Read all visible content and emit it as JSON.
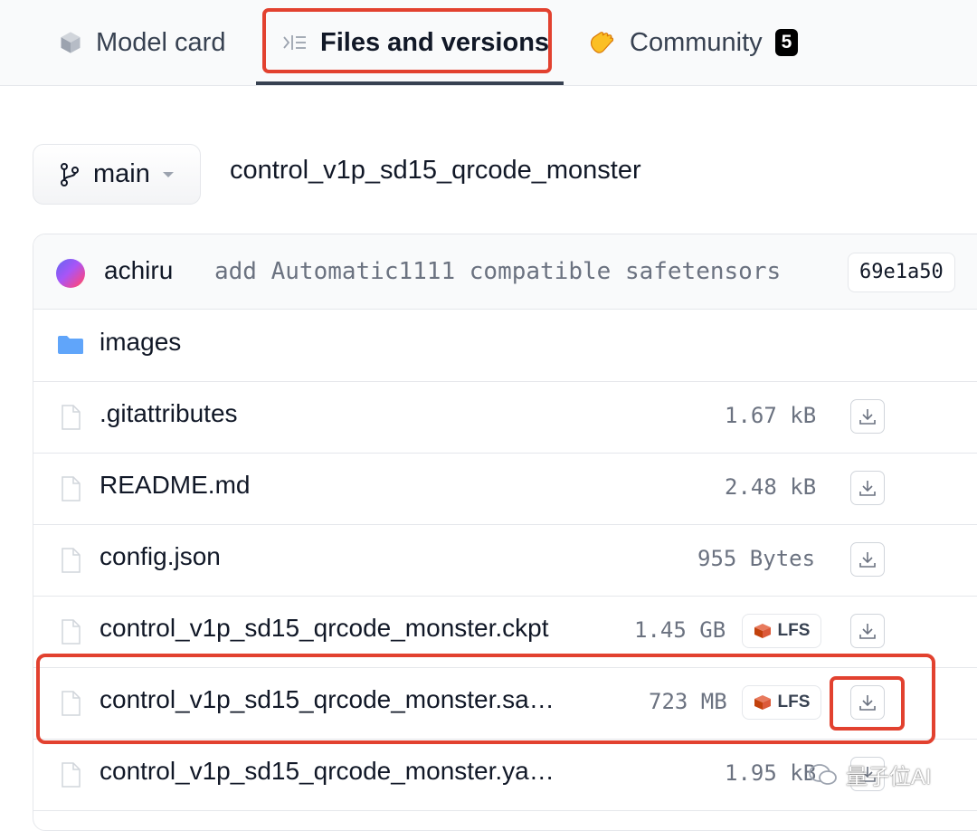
{
  "tabs": [
    {
      "label": "Model card",
      "icon": "cube-icon"
    },
    {
      "label": "Files and versions",
      "icon": "list-icon",
      "active": true
    },
    {
      "label": "Community",
      "icon": "clap-icon",
      "badge": "5"
    }
  ],
  "branch": {
    "label": "main",
    "icon": "git-branch-icon"
  },
  "repo_name": "control_v1p_sd15_qrcode_monster",
  "commit": {
    "author": "achiru",
    "message": "add Automatic1111 compatible safetensors",
    "hash": "69e1a50"
  },
  "files": [
    {
      "name": "images",
      "type": "folder"
    },
    {
      "name": ".gitattributes",
      "type": "file",
      "size": "1.67 kB"
    },
    {
      "name": "README.md",
      "type": "file",
      "size": "2.48 kB"
    },
    {
      "name": "config.json",
      "type": "file",
      "size": "955 Bytes"
    },
    {
      "name": "control_v1p_sd15_qrcode_monster.ckpt",
      "type": "file",
      "size": "1.45 GB",
      "lfs": "LFS"
    },
    {
      "name": "control_v1p_sd15_qrcode_monster.sa…",
      "type": "file",
      "size": "723 MB",
      "lfs": "LFS"
    },
    {
      "name": "control_v1p_sd15_qrcode_monster.ya…",
      "type": "file",
      "size": "1.95 kB"
    }
  ],
  "watermark": "量子位AI",
  "colors": {
    "highlight": "#e2412f",
    "folder": "#60a5fa",
    "lfs": "#dc5a3a",
    "avatar": [
      "#6366f1",
      "#ec4899",
      "#f97316"
    ]
  }
}
